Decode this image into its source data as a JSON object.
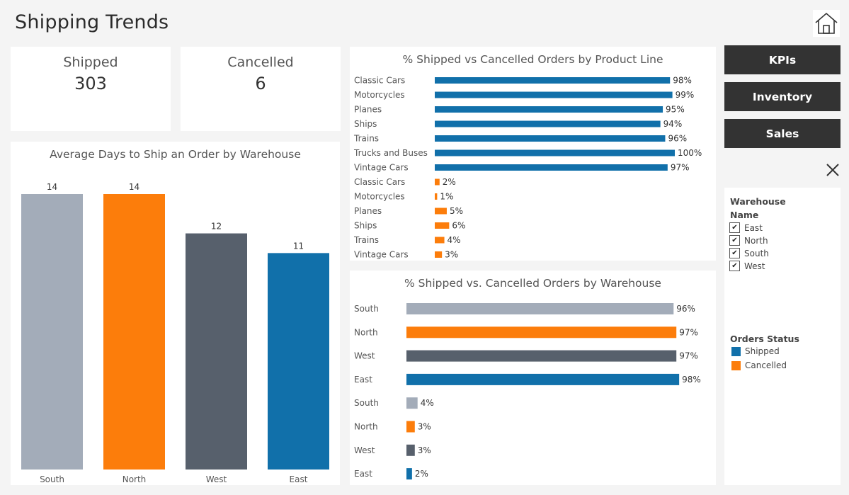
{
  "page": {
    "title": "Shipping Trends"
  },
  "kpis": {
    "shipped": {
      "label": "Shipped",
      "value": "303"
    },
    "cancelled": {
      "label": "Cancelled",
      "value": "6"
    }
  },
  "nav": {
    "kpis": "KPIs",
    "inventory": "Inventory",
    "sales": "Sales"
  },
  "filter": {
    "title_line1": "Warehouse",
    "title_line2": "Name",
    "items": [
      {
        "label": "East",
        "checked": true
      },
      {
        "label": "North",
        "checked": true
      },
      {
        "label": "South",
        "checked": true
      },
      {
        "label": "West",
        "checked": true
      }
    ]
  },
  "legend": {
    "title": "Orders Status",
    "items": [
      {
        "label": "Shipped",
        "color": "#1170aa"
      },
      {
        "label": "Cancelled",
        "color": "#fc7d0b"
      }
    ]
  },
  "colors": {
    "shipped": "#1170aa",
    "cancelled": "#fc7d0b",
    "south": "#a3acb9",
    "north": "#fc7d0b",
    "west": "#57606c",
    "east": "#1170aa"
  },
  "chart_data": [
    {
      "type": "bar",
      "title": "Average Days to Ship an Order by Warehouse",
      "categories": [
        "South",
        "North",
        "West",
        "East"
      ],
      "values": [
        14,
        14,
        12,
        11
      ],
      "data_labels": [
        "14",
        "14",
        "12",
        "11"
      ],
      "bar_colors": [
        "#a3acb9",
        "#fc7d0b",
        "#57606c",
        "#1170aa"
      ],
      "ylim": [
        0,
        15
      ],
      "grid": false
    },
    {
      "type": "bar",
      "orientation": "horizontal",
      "title": "% Shipped vs Cancelled Orders by Product Line",
      "rows": [
        {
          "label": "Classic Cars",
          "value": 98,
          "text": "98%",
          "status": "Shipped"
        },
        {
          "label": "Motorcycles",
          "value": 99,
          "text": "99%",
          "status": "Shipped"
        },
        {
          "label": "Planes",
          "value": 95,
          "text": "95%",
          "status": "Shipped"
        },
        {
          "label": "Ships",
          "value": 94,
          "text": "94%",
          "status": "Shipped"
        },
        {
          "label": "Trains",
          "value": 96,
          "text": "96%",
          "status": "Shipped"
        },
        {
          "label": "Trucks and Buses",
          "value": 100,
          "text": "100%",
          "status": "Shipped"
        },
        {
          "label": "Vintage Cars",
          "value": 97,
          "text": "97%",
          "status": "Shipped"
        },
        {
          "label": "Classic Cars",
          "value": 2,
          "text": "2%",
          "status": "Cancelled"
        },
        {
          "label": "Motorcycles",
          "value": 1,
          "text": "1%",
          "status": "Cancelled"
        },
        {
          "label": "Planes",
          "value": 5,
          "text": "5%",
          "status": "Cancelled"
        },
        {
          "label": "Ships",
          "value": 6,
          "text": "6%",
          "status": "Cancelled"
        },
        {
          "label": "Trains",
          "value": 4,
          "text": "4%",
          "status": "Cancelled"
        },
        {
          "label": "Vintage Cars",
          "value": 3,
          "text": "3%",
          "status": "Cancelled"
        }
      ],
      "xlim": [
        0,
        100
      ]
    },
    {
      "type": "bar",
      "orientation": "horizontal",
      "title": "% Shipped vs. Cancelled Orders by Warehouse",
      "rows": [
        {
          "label": "South",
          "value": 96,
          "text": "96%",
          "color": "#a3acb9"
        },
        {
          "label": "North",
          "value": 97,
          "text": "97%",
          "color": "#fc7d0b"
        },
        {
          "label": "West",
          "value": 97,
          "text": "97%",
          "color": "#57606c"
        },
        {
          "label": "East",
          "value": 98,
          "text": "98%",
          "color": "#1170aa"
        },
        {
          "label": "South",
          "value": 4,
          "text": "4%",
          "color": "#a3acb9"
        },
        {
          "label": "North",
          "value": 3,
          "text": "3%",
          "color": "#fc7d0b"
        },
        {
          "label": "West",
          "value": 3,
          "text": "3%",
          "color": "#57606c"
        },
        {
          "label": "East",
          "value": 2,
          "text": "2%",
          "color": "#1170aa"
        }
      ],
      "xlim": [
        0,
        100
      ]
    }
  ]
}
